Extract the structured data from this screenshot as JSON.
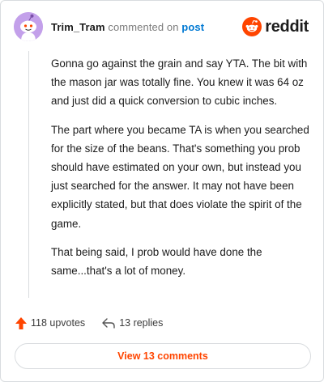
{
  "comment": {
    "username": "Trim_Tram",
    "commented_text": "commented on",
    "post_link": "post",
    "brand": "reddit",
    "paragraphs": [
      "Gonna go against the grain and say YTA. The bit with the mason jar was totally fine. You knew it was 64 oz and just did a quick conversion to cubic inches.",
      "The part where you became TA is when you searched for the size of the beans. That's something you prob should have estimated on your own, but instead you just searched for the answer. It may not have been explicitly stated, but that does violate the spirit of the game.",
      "That being said, I prob would have done the same...that's a lot of money."
    ]
  },
  "actions": {
    "upvotes": "118 upvotes",
    "replies": "13 replies",
    "view_comments": "View 13 comments"
  },
  "colors": {
    "accent": "#ff4500",
    "link": "#0079d3",
    "avatar_bg": "#c3a0ea"
  },
  "icons": [
    "snoo-avatar-icon",
    "reddit-logo-icon",
    "upvote-arrow-icon",
    "reply-arrow-icon"
  ]
}
